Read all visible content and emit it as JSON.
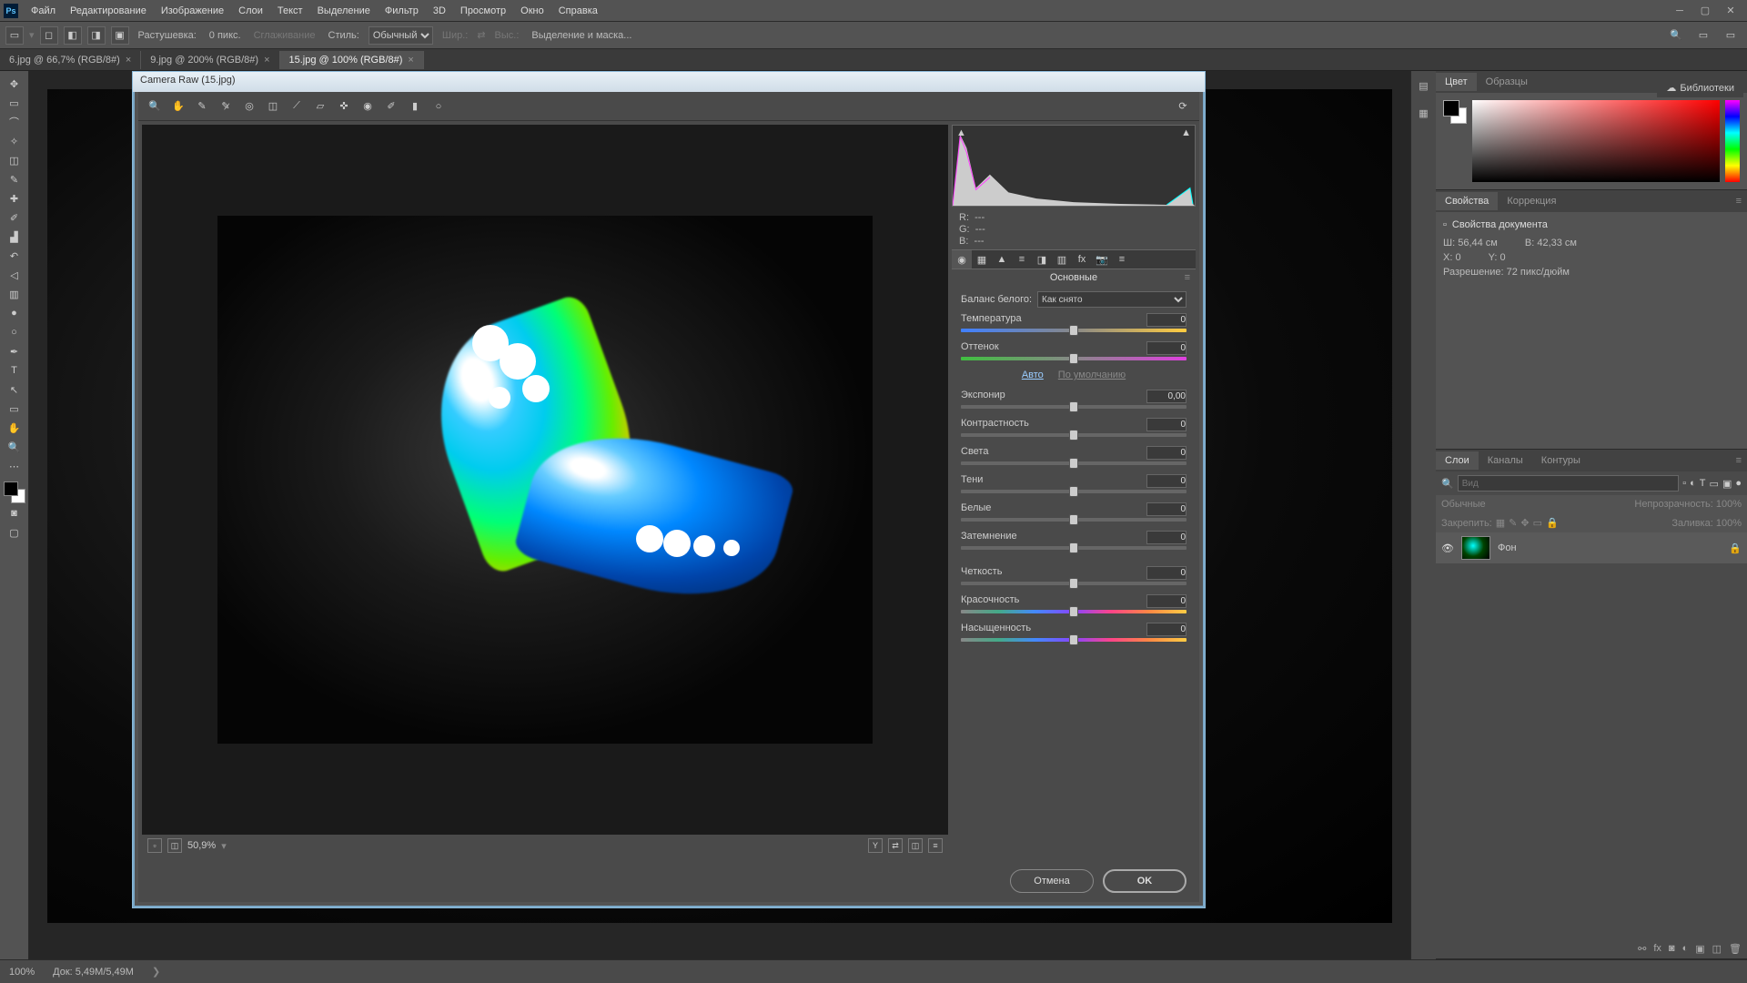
{
  "menu": [
    "Файл",
    "Редактирование",
    "Изображение",
    "Слои",
    "Текст",
    "Выделение",
    "Фильтр",
    "3D",
    "Просмотр",
    "Окно",
    "Справка"
  ],
  "optbar": {
    "feather_label": "Растушевка:",
    "feather_value": "0 пикс.",
    "smooth_label": "Сглаживание",
    "style_label": "Стиль:",
    "style_value": "Обычный",
    "width_label": "Шир.:",
    "height_label": "Выс.:",
    "refine": "Выделение и маска..."
  },
  "tabs": [
    {
      "label": "6.jpg @ 66,7% (RGB/8#)",
      "active": false
    },
    {
      "label": "9.jpg @ 200% (RGB/8#)",
      "active": false
    },
    {
      "label": "15.jpg @ 100% (RGB/8#)",
      "active": true
    }
  ],
  "libraries": "Библиотеки",
  "panels": {
    "color": {
      "tabs": [
        "Цвет",
        "Образцы"
      ]
    },
    "props": {
      "tabs": [
        "Свойства",
        "Коррекция"
      ],
      "doc_label": "Свойства документа",
      "w_label": "Ш:",
      "w_val": "56,44 см",
      "h_label": "В:",
      "h_val": "42,33 см",
      "x_label": "X:",
      "x_val": "0",
      "y_label": "Y:",
      "y_val": "0",
      "res": "Разрешение: 72 пикс/дюйм"
    },
    "layers": {
      "tabs": [
        "Слои",
        "Каналы",
        "Контуры"
      ],
      "search_ph": "Вид",
      "blend": "Обычные",
      "opacity_label": "Непрозрачность:",
      "opacity_val": "100%",
      "lock_label": "Закрепить:",
      "fill_label": "Заливка:",
      "fill_val": "100%",
      "layer_name": "Фон"
    }
  },
  "status": {
    "zoom": "100%",
    "doc": "Док: 5,49M/5,49M"
  },
  "cr": {
    "title": "Camera Raw (15.jpg)",
    "zoom": "50,9%",
    "rgb": {
      "r": "R:",
      "g": "G:",
      "b": "B:",
      "dash": "---"
    },
    "panel_title": "Основные",
    "wb_label": "Баланс белого:",
    "wb_value": "Как снято",
    "auto": "Авто",
    "default": "По умолчанию",
    "sliders": {
      "temp": {
        "label": "Температура",
        "val": "0"
      },
      "tint": {
        "label": "Оттенок",
        "val": "0"
      },
      "exp": {
        "label": "Экспонир",
        "val": "0,00"
      },
      "contrast": {
        "label": "Контрастность",
        "val": "0"
      },
      "high": {
        "label": "Света",
        "val": "0"
      },
      "shad": {
        "label": "Тени",
        "val": "0"
      },
      "white": {
        "label": "Белые",
        "val": "0"
      },
      "black": {
        "label": "Затемнение",
        "val": "0"
      },
      "clar": {
        "label": "Четкость",
        "val": "0"
      },
      "vib": {
        "label": "Красочность",
        "val": "0"
      },
      "sat": {
        "label": "Насыщенность",
        "val": "0"
      }
    },
    "cancel": "Отмена",
    "ok": "OK"
  }
}
